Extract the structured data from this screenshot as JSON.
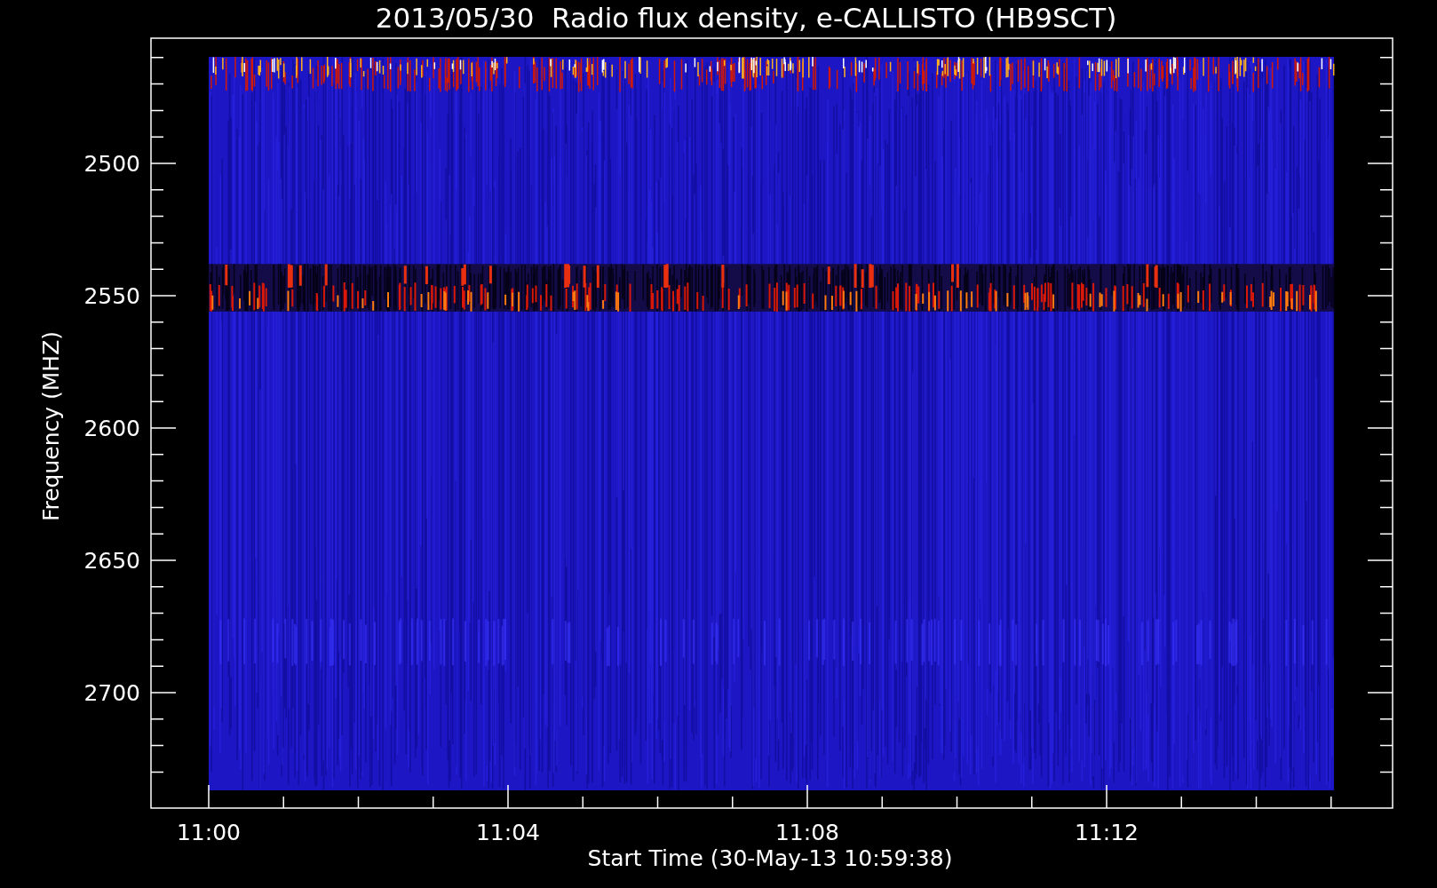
{
  "title": "2013/05/30  Radio flux density, e-CALLISTO (HB9SCT)",
  "y_axis": {
    "label": "Frequency (MHZ)",
    "tick_labels": [
      "2500",
      "2550",
      "2600",
      "2650",
      "2700"
    ]
  },
  "x_axis": {
    "label": "Start Time (30-May-13 10:59:38)",
    "tick_labels": [
      "11:00",
      "11:04",
      "11:08",
      "11:12"
    ]
  }
}
